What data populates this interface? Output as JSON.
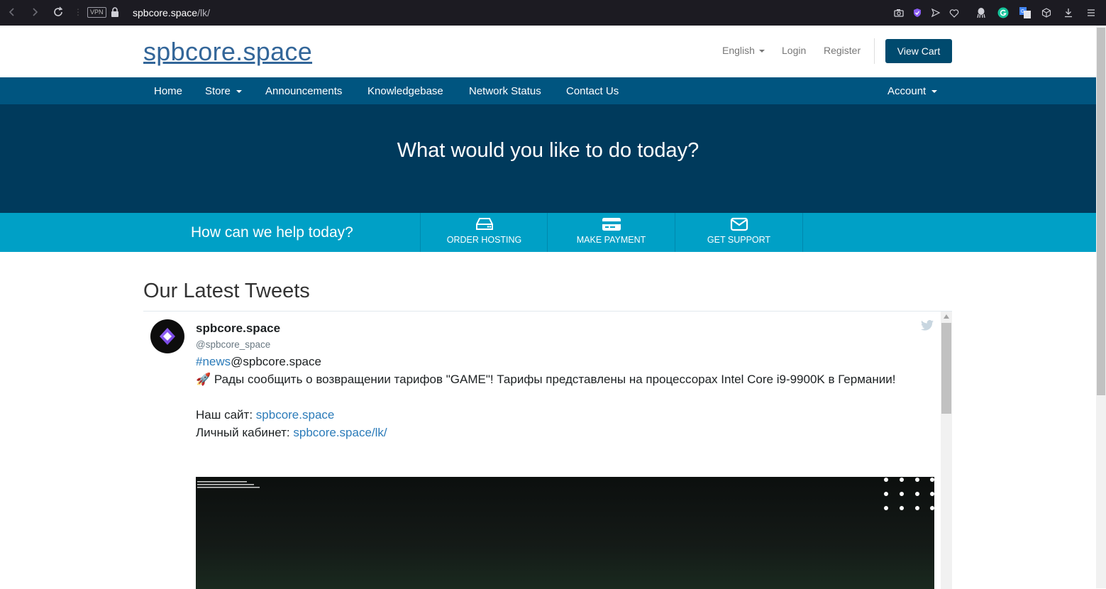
{
  "browser": {
    "url_host": "spbcore.space",
    "url_path": "/lk/",
    "vpn_label": "VPN"
  },
  "header": {
    "logo": "spbcore.space",
    "language": "English",
    "login": "Login",
    "register": "Register",
    "view_cart": "View Cart"
  },
  "nav": {
    "home": "Home",
    "store": "Store",
    "announcements": "Announcements",
    "knowledgebase": "Knowledgebase",
    "network_status": "Network Status",
    "contact_us": "Contact Us",
    "account": "Account"
  },
  "hero": {
    "title": "What would you like to do today?"
  },
  "help": {
    "text": "How can we help today?",
    "actions": [
      {
        "label": "ORDER HOSTING",
        "icon": "server-icon"
      },
      {
        "label": "MAKE PAYMENT",
        "icon": "credit-card-icon"
      },
      {
        "label": "GET SUPPORT",
        "icon": "envelope-icon"
      }
    ]
  },
  "tweets": {
    "section_title": "Our Latest Tweets",
    "name": "spbcore.space",
    "handle": "@spbcore_space",
    "hashtag": "#news",
    "mention": "@spbcore.space",
    "line1": "🚀 Рады сообщить о возвращении тарифов \"GAME\"! Тарифы представлены на процессорах Intel Core i9-9900K в Германии!",
    "site_label": "Наш сайт: ",
    "site_link": "spbcore.space",
    "lk_label": "Личный кабинет: ",
    "lk_link": "spbcore.space/lk/"
  },
  "colors": {
    "nav_bg": "#005580",
    "hero_bg": "#003a5c",
    "helpbar_bg": "#00a0c6",
    "cart_btn": "#004a6e",
    "logo": "#336699"
  }
}
